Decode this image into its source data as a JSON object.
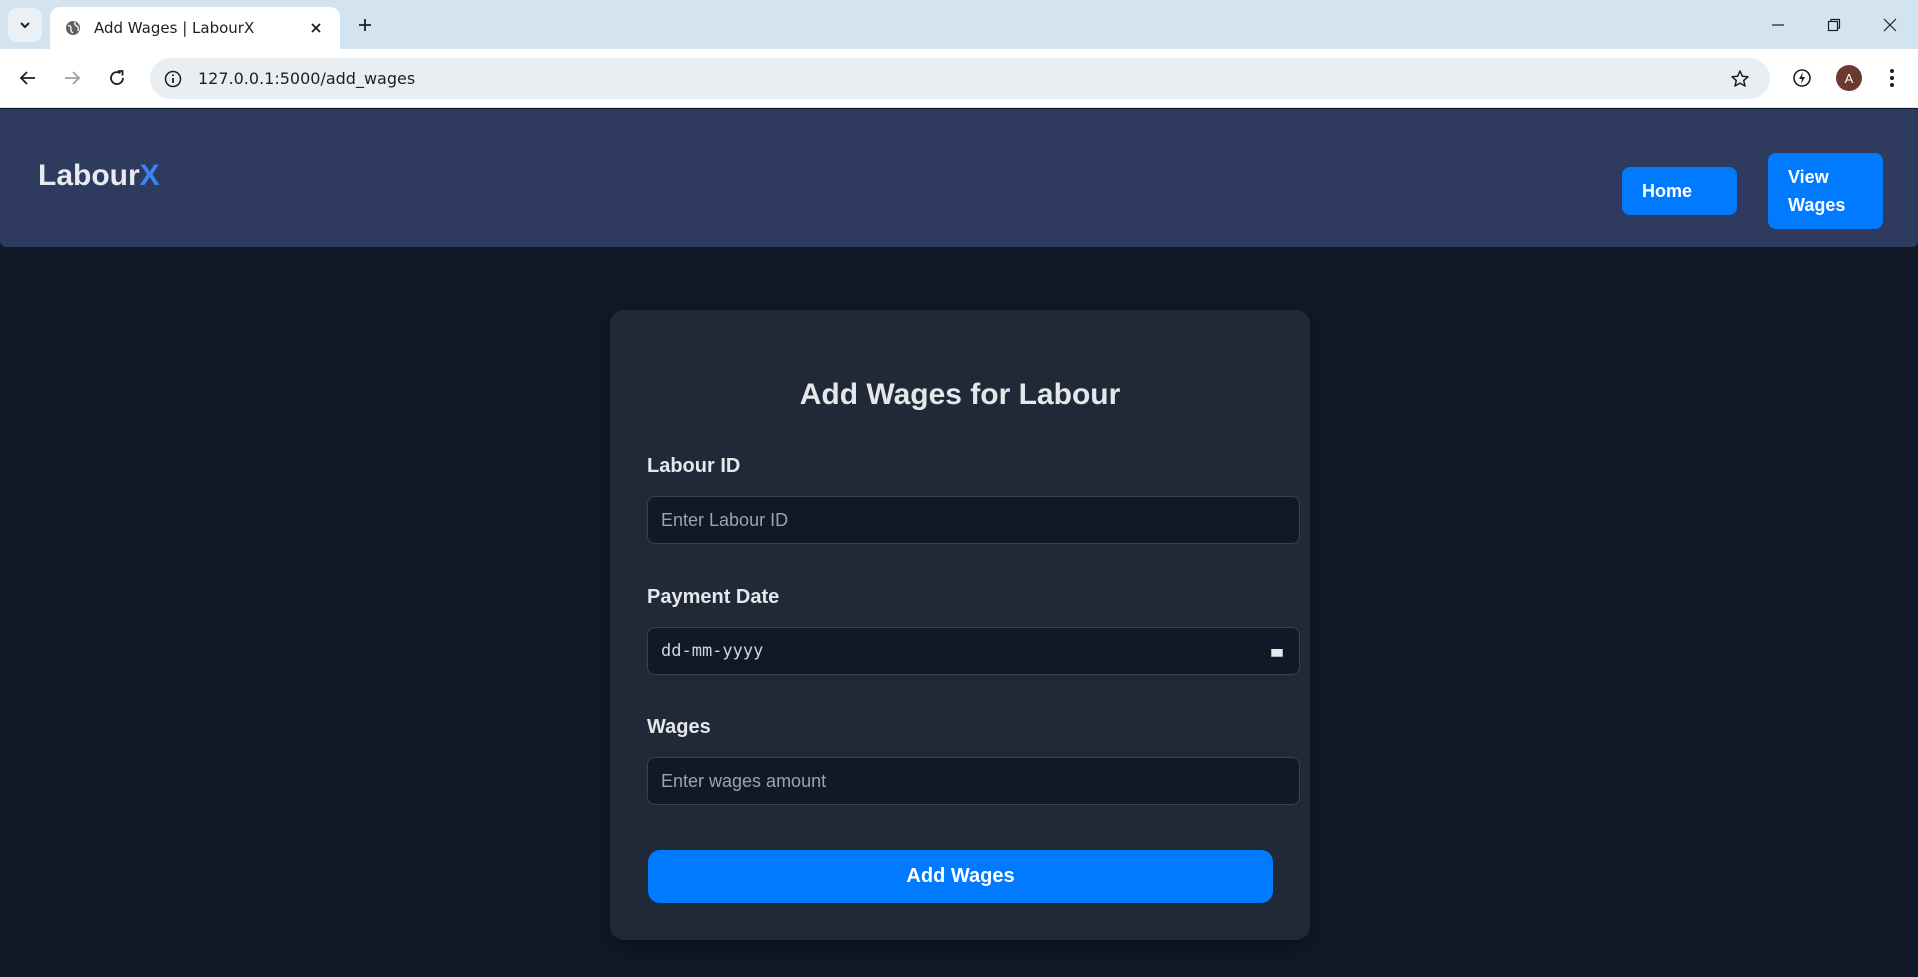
{
  "browser": {
    "tab_title": "Add Wages | LabourX",
    "url": "127.0.0.1:5000/add_wages",
    "profile_initial": "A"
  },
  "header": {
    "logo_main": "Labour",
    "logo_accent": "X",
    "nav": {
      "home": "Home",
      "view_wages_line1": "View",
      "view_wages_line2": "Wages"
    }
  },
  "form": {
    "title": "Add Wages for Labour",
    "labour_id": {
      "label": "Labour ID",
      "placeholder": "Enter Labour ID"
    },
    "payment_date": {
      "label": "Payment Date",
      "placeholder": "dd-mm-yyyy"
    },
    "wages": {
      "label": "Wages",
      "placeholder": "Enter wages amount"
    },
    "submit_label": "Add Wages"
  },
  "colors": {
    "page_bg": "#111827",
    "header_bg": "#2e3b5e",
    "card_bg": "#1f2937",
    "accent": "#007bff",
    "logo_accent": "#3b82f6"
  }
}
